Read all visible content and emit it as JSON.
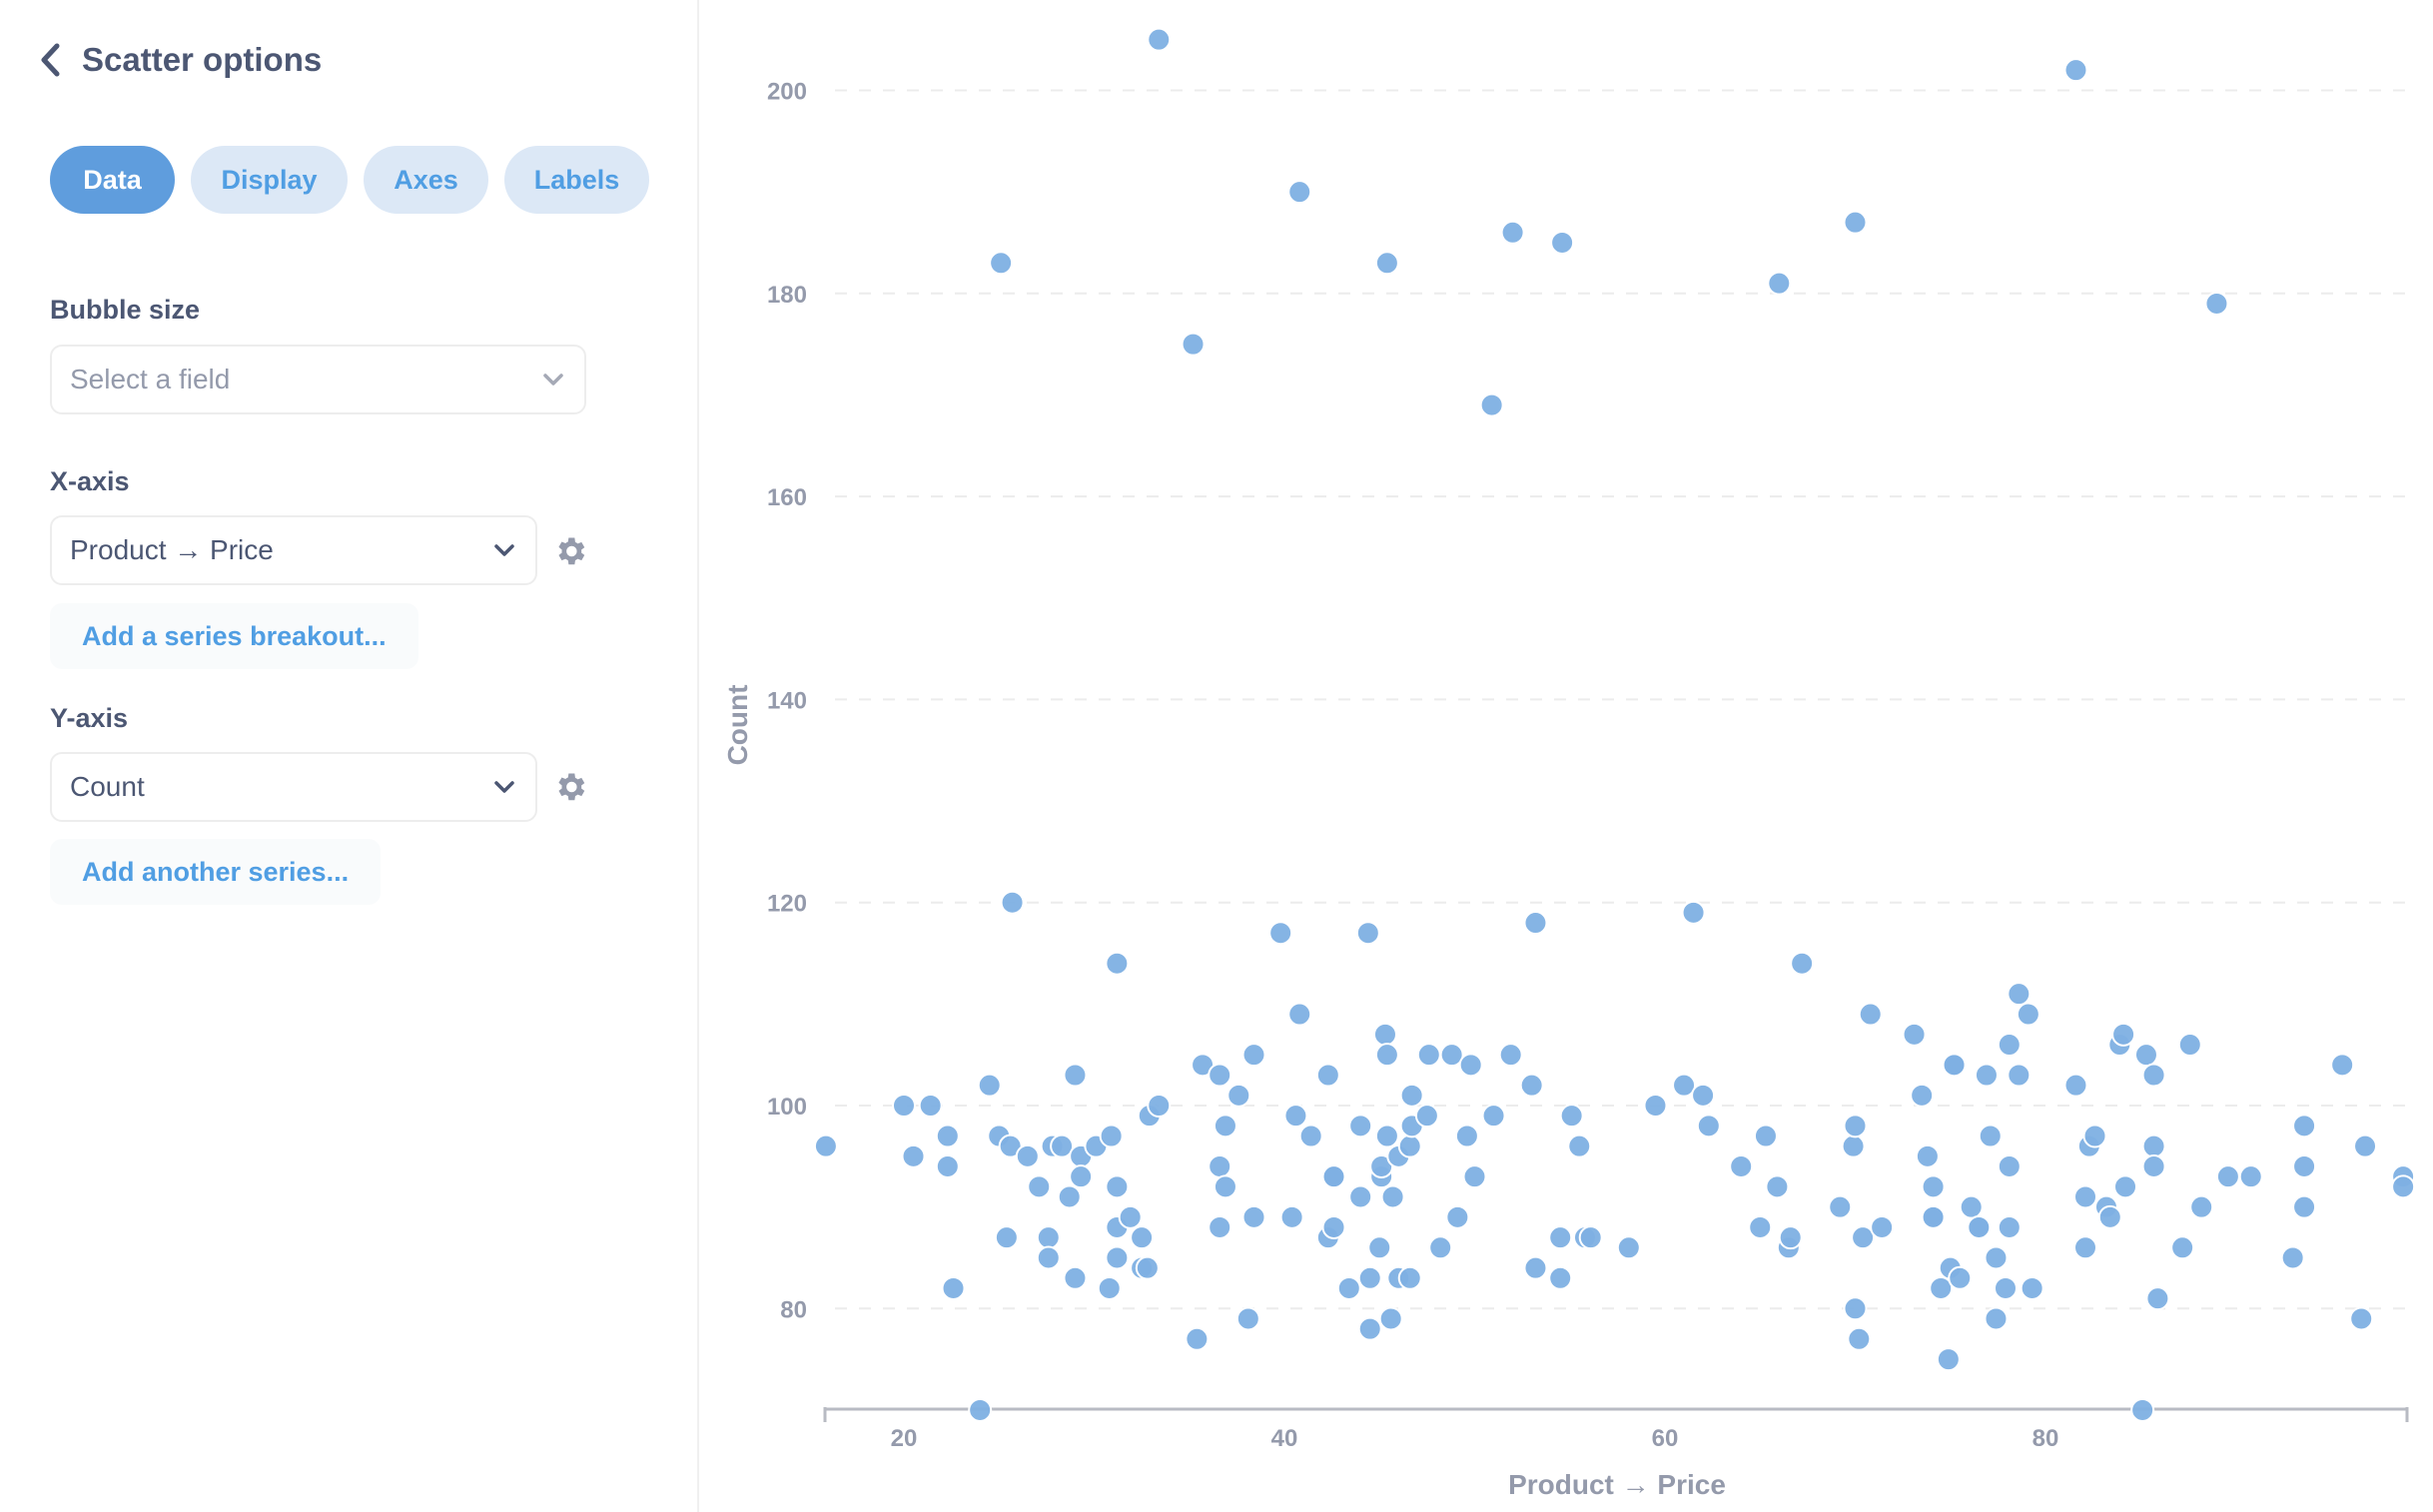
{
  "sidebar": {
    "title": "Scatter options",
    "back_icon": "chevron-left-icon",
    "tabs": [
      {
        "label": "Data",
        "active": true
      },
      {
        "label": "Display",
        "active": false
      },
      {
        "label": "Axes",
        "active": false
      },
      {
        "label": "Labels",
        "active": false
      }
    ],
    "bubble_size": {
      "label": "Bubble size",
      "placeholder": "Select a field"
    },
    "x_axis": {
      "label": "X-axis",
      "value": "Product → Price",
      "add_label": "Add a series breakout..."
    },
    "y_axis": {
      "label": "Y-axis",
      "value": "Count",
      "add_label": "Add another series..."
    }
  },
  "colors": {
    "accent": "#509ee3",
    "point": "#7eb0e3",
    "text": "#4c5773",
    "muted": "#949aab"
  },
  "chart_data": {
    "type": "scatter",
    "title": "",
    "xlabel": "Product → Price",
    "ylabel": "Count",
    "xlim": [
      15.7,
      98.9
    ],
    "ylim": [
      70,
      206
    ],
    "x_ticks": [
      20,
      40,
      60,
      80
    ],
    "y_ticks": [
      80,
      100,
      120,
      140,
      160,
      180,
      200
    ],
    "grid": "horizontal-dashed",
    "legend": "none",
    "series": [
      {
        "name": "Count",
        "points": [
          [
            33.4,
            205
          ],
          [
            25.1,
            183
          ],
          [
            40.8,
            190
          ],
          [
            35.2,
            175
          ],
          [
            45.4,
            183
          ],
          [
            52.0,
            186
          ],
          [
            54.6,
            185
          ],
          [
            50.9,
            169
          ],
          [
            66.0,
            181
          ],
          [
            70.0,
            187
          ],
          [
            81.6,
            202
          ],
          [
            89.0,
            179
          ],
          [
            15.9,
            96
          ],
          [
            20.0,
            100
          ],
          [
            20.5,
            95
          ],
          [
            21.4,
            100
          ],
          [
            22.3,
            97
          ],
          [
            22.3,
            94
          ],
          [
            22.6,
            82
          ],
          [
            24.0,
            70
          ],
          [
            24.5,
            102
          ],
          [
            25.0,
            97
          ],
          [
            25.4,
            87
          ],
          [
            25.6,
            96
          ],
          [
            25.7,
            120
          ],
          [
            26.5,
            95
          ],
          [
            27.1,
            92
          ],
          [
            27.6,
            87
          ],
          [
            27.6,
            85
          ],
          [
            27.8,
            96
          ],
          [
            28.3,
            96
          ],
          [
            28.7,
            91
          ],
          [
            29.0,
            103
          ],
          [
            29.0,
            83
          ],
          [
            29.3,
            95
          ],
          [
            29.3,
            93
          ],
          [
            30.1,
            96
          ],
          [
            30.9,
            97
          ],
          [
            30.8,
            82
          ],
          [
            31.2,
            92
          ],
          [
            31.2,
            88
          ],
          [
            31.2,
            85
          ],
          [
            31.2,
            114
          ],
          [
            31.9,
            89
          ],
          [
            32.5,
            87
          ],
          [
            32.5,
            84
          ],
          [
            32.8,
            84
          ],
          [
            32.9,
            99
          ],
          [
            33.4,
            100
          ],
          [
            35.4,
            77
          ],
          [
            35.7,
            104
          ],
          [
            36.6,
            103
          ],
          [
            36.6,
            94
          ],
          [
            36.6,
            88
          ],
          [
            36.9,
            98
          ],
          [
            36.9,
            92
          ],
          [
            37.6,
            101
          ],
          [
            38.1,
            79
          ],
          [
            38.4,
            105
          ],
          [
            38.4,
            89
          ],
          [
            39.8,
            117
          ],
          [
            40.4,
            89
          ],
          [
            40.6,
            99
          ],
          [
            40.8,
            109
          ],
          [
            41.4,
            97
          ],
          [
            42.3,
            103
          ],
          [
            42.3,
            87
          ],
          [
            42.6,
            93
          ],
          [
            42.6,
            88
          ],
          [
            42.6,
            93
          ],
          [
            43.4,
            82
          ],
          [
            44.0,
            98
          ],
          [
            44.0,
            91
          ],
          [
            44.4,
            117
          ],
          [
            44.5,
            78
          ],
          [
            44.5,
            83
          ],
          [
            45.0,
            86
          ],
          [
            45.1,
            93
          ],
          [
            45.1,
            94
          ],
          [
            45.3,
            107
          ],
          [
            45.4,
            105
          ],
          [
            45.4,
            97
          ],
          [
            45.6,
            79
          ],
          [
            45.7,
            91
          ],
          [
            46.0,
            95
          ],
          [
            46.0,
            83
          ],
          [
            46.6,
            83
          ],
          [
            46.6,
            96
          ],
          [
            46.7,
            101
          ],
          [
            46.7,
            98
          ],
          [
            47.5,
            99
          ],
          [
            47.6,
            105
          ],
          [
            48.2,
            86
          ],
          [
            48.8,
            105
          ],
          [
            49.1,
            89
          ],
          [
            49.6,
            97
          ],
          [
            49.8,
            104
          ],
          [
            50.0,
            93
          ],
          [
            51.0,
            99
          ],
          [
            51.9,
            105
          ],
          [
            53.0,
            102
          ],
          [
            53.2,
            118
          ],
          [
            53.2,
            84
          ],
          [
            54.5,
            87
          ],
          [
            54.5,
            83
          ],
          [
            55.1,
            99
          ],
          [
            55.5,
            96
          ],
          [
            55.8,
            87
          ],
          [
            56.1,
            87
          ],
          [
            58.1,
            86
          ],
          [
            59.5,
            100
          ],
          [
            61.0,
            102
          ],
          [
            61.5,
            119
          ],
          [
            62.0,
            101
          ],
          [
            62.3,
            98
          ],
          [
            64.0,
            94
          ],
          [
            65.0,
            88
          ],
          [
            65.3,
            97
          ],
          [
            65.9,
            92
          ],
          [
            66.5,
            86
          ],
          [
            66.6,
            87
          ],
          [
            67.2,
            114
          ],
          [
            69.2,
            90
          ],
          [
            69.9,
            96
          ],
          [
            70.0,
            98
          ],
          [
            70.0,
            80
          ],
          [
            70.2,
            77
          ],
          [
            70.4,
            87
          ],
          [
            70.8,
            109
          ],
          [
            71.4,
            88
          ],
          [
            73.1,
            107
          ],
          [
            73.5,
            101
          ],
          [
            73.8,
            95
          ],
          [
            74.1,
            92
          ],
          [
            74.1,
            89
          ],
          [
            74.1,
            89
          ],
          [
            74.5,
            82
          ],
          [
            74.9,
            75
          ],
          [
            75.0,
            84
          ],
          [
            75.2,
            104
          ],
          [
            75.2,
            104
          ],
          [
            75.5,
            83
          ],
          [
            76.1,
            90
          ],
          [
            76.5,
            88
          ],
          [
            76.5,
            88
          ],
          [
            76.9,
            103
          ],
          [
            77.1,
            97
          ],
          [
            77.4,
            85
          ],
          [
            77.4,
            79
          ],
          [
            77.9,
            82
          ],
          [
            78.1,
            106
          ],
          [
            78.1,
            94
          ],
          [
            78.1,
            88
          ],
          [
            78.6,
            111
          ],
          [
            78.6,
            103
          ],
          [
            79.1,
            109
          ],
          [
            79.3,
            82
          ],
          [
            81.6,
            102
          ],
          [
            82.1,
            91
          ],
          [
            82.1,
            86
          ],
          [
            82.3,
            96
          ],
          [
            82.6,
            97
          ],
          [
            83.2,
            90
          ],
          [
            83.4,
            89
          ],
          [
            83.9,
            106
          ],
          [
            84.1,
            107
          ],
          [
            84.2,
            92
          ],
          [
            85.1,
            70
          ],
          [
            85.3,
            105
          ],
          [
            85.7,
            103
          ],
          [
            85.7,
            96
          ],
          [
            85.7,
            94
          ],
          [
            85.9,
            81
          ],
          [
            87.2,
            86
          ],
          [
            87.6,
            106
          ],
          [
            88.2,
            90
          ],
          [
            89.6,
            93
          ],
          [
            90.8,
            93
          ],
          [
            93.0,
            85
          ],
          [
            93.6,
            98
          ],
          [
            93.6,
            94
          ],
          [
            93.6,
            90
          ],
          [
            95.6,
            104
          ],
          [
            96.6,
            79
          ],
          [
            96.8,
            96
          ],
          [
            98.8,
            93
          ],
          [
            98.8,
            92
          ]
        ]
      }
    ]
  }
}
